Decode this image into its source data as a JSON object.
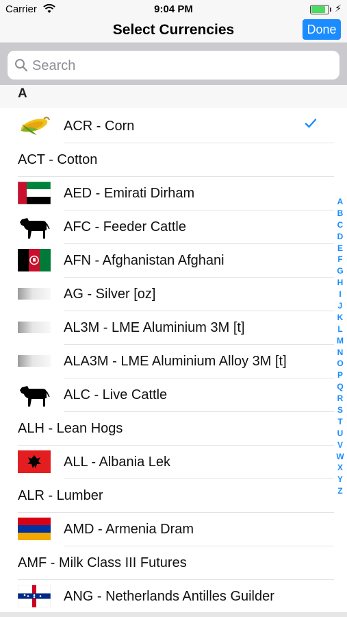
{
  "status": {
    "carrier": "Carrier",
    "time": "9:04 PM",
    "battery_level": 0.9
  },
  "nav": {
    "title": "Select Currencies",
    "done_label": "Done"
  },
  "search": {
    "placeholder": "Search"
  },
  "section": {
    "letter": "A"
  },
  "items": [
    {
      "label": "ACR - Corn",
      "icon": "corn-icon",
      "checked": true
    },
    {
      "label": "ACT - Cotton",
      "icon": null
    },
    {
      "label": "AED - Emirati Dirham",
      "icon": "uae-flag-icon"
    },
    {
      "label": "AFC - Feeder Cattle",
      "icon": "cattle-icon"
    },
    {
      "label": "AFN - Afghanistan Afghani",
      "icon": "afghanistan-flag-icon"
    },
    {
      "label": "AG - Silver [oz]",
      "icon": "metal-bar-icon"
    },
    {
      "label": "AL3M - LME Aluminium 3M [t]",
      "icon": "metal-bar-icon"
    },
    {
      "label": "ALA3M - LME Aluminium Alloy 3M [t]",
      "icon": "metal-bar-icon"
    },
    {
      "label": "ALC - Live Cattle",
      "icon": "cattle-icon"
    },
    {
      "label": "ALH - Lean Hogs",
      "icon": null
    },
    {
      "label": "ALL - Albania Lek",
      "icon": "albania-flag-icon"
    },
    {
      "label": "ALR - Lumber",
      "icon": null
    },
    {
      "label": "AMD - Armenia Dram",
      "icon": "armenia-flag-icon"
    },
    {
      "label": "AMF - Milk Class III Futures",
      "icon": null
    },
    {
      "label": "ANG - Netherlands Antilles Guilder",
      "icon": "netherlands-antilles-flag-icon"
    }
  ],
  "index_letters": [
    "A",
    "B",
    "C",
    "D",
    "E",
    "F",
    "G",
    "H",
    "I",
    "J",
    "K",
    "L",
    "M",
    "N",
    "O",
    "P",
    "Q",
    "R",
    "S",
    "T",
    "U",
    "V",
    "W",
    "X",
    "Y",
    "Z"
  ],
  "colors": {
    "accent": "#1a8cff"
  }
}
